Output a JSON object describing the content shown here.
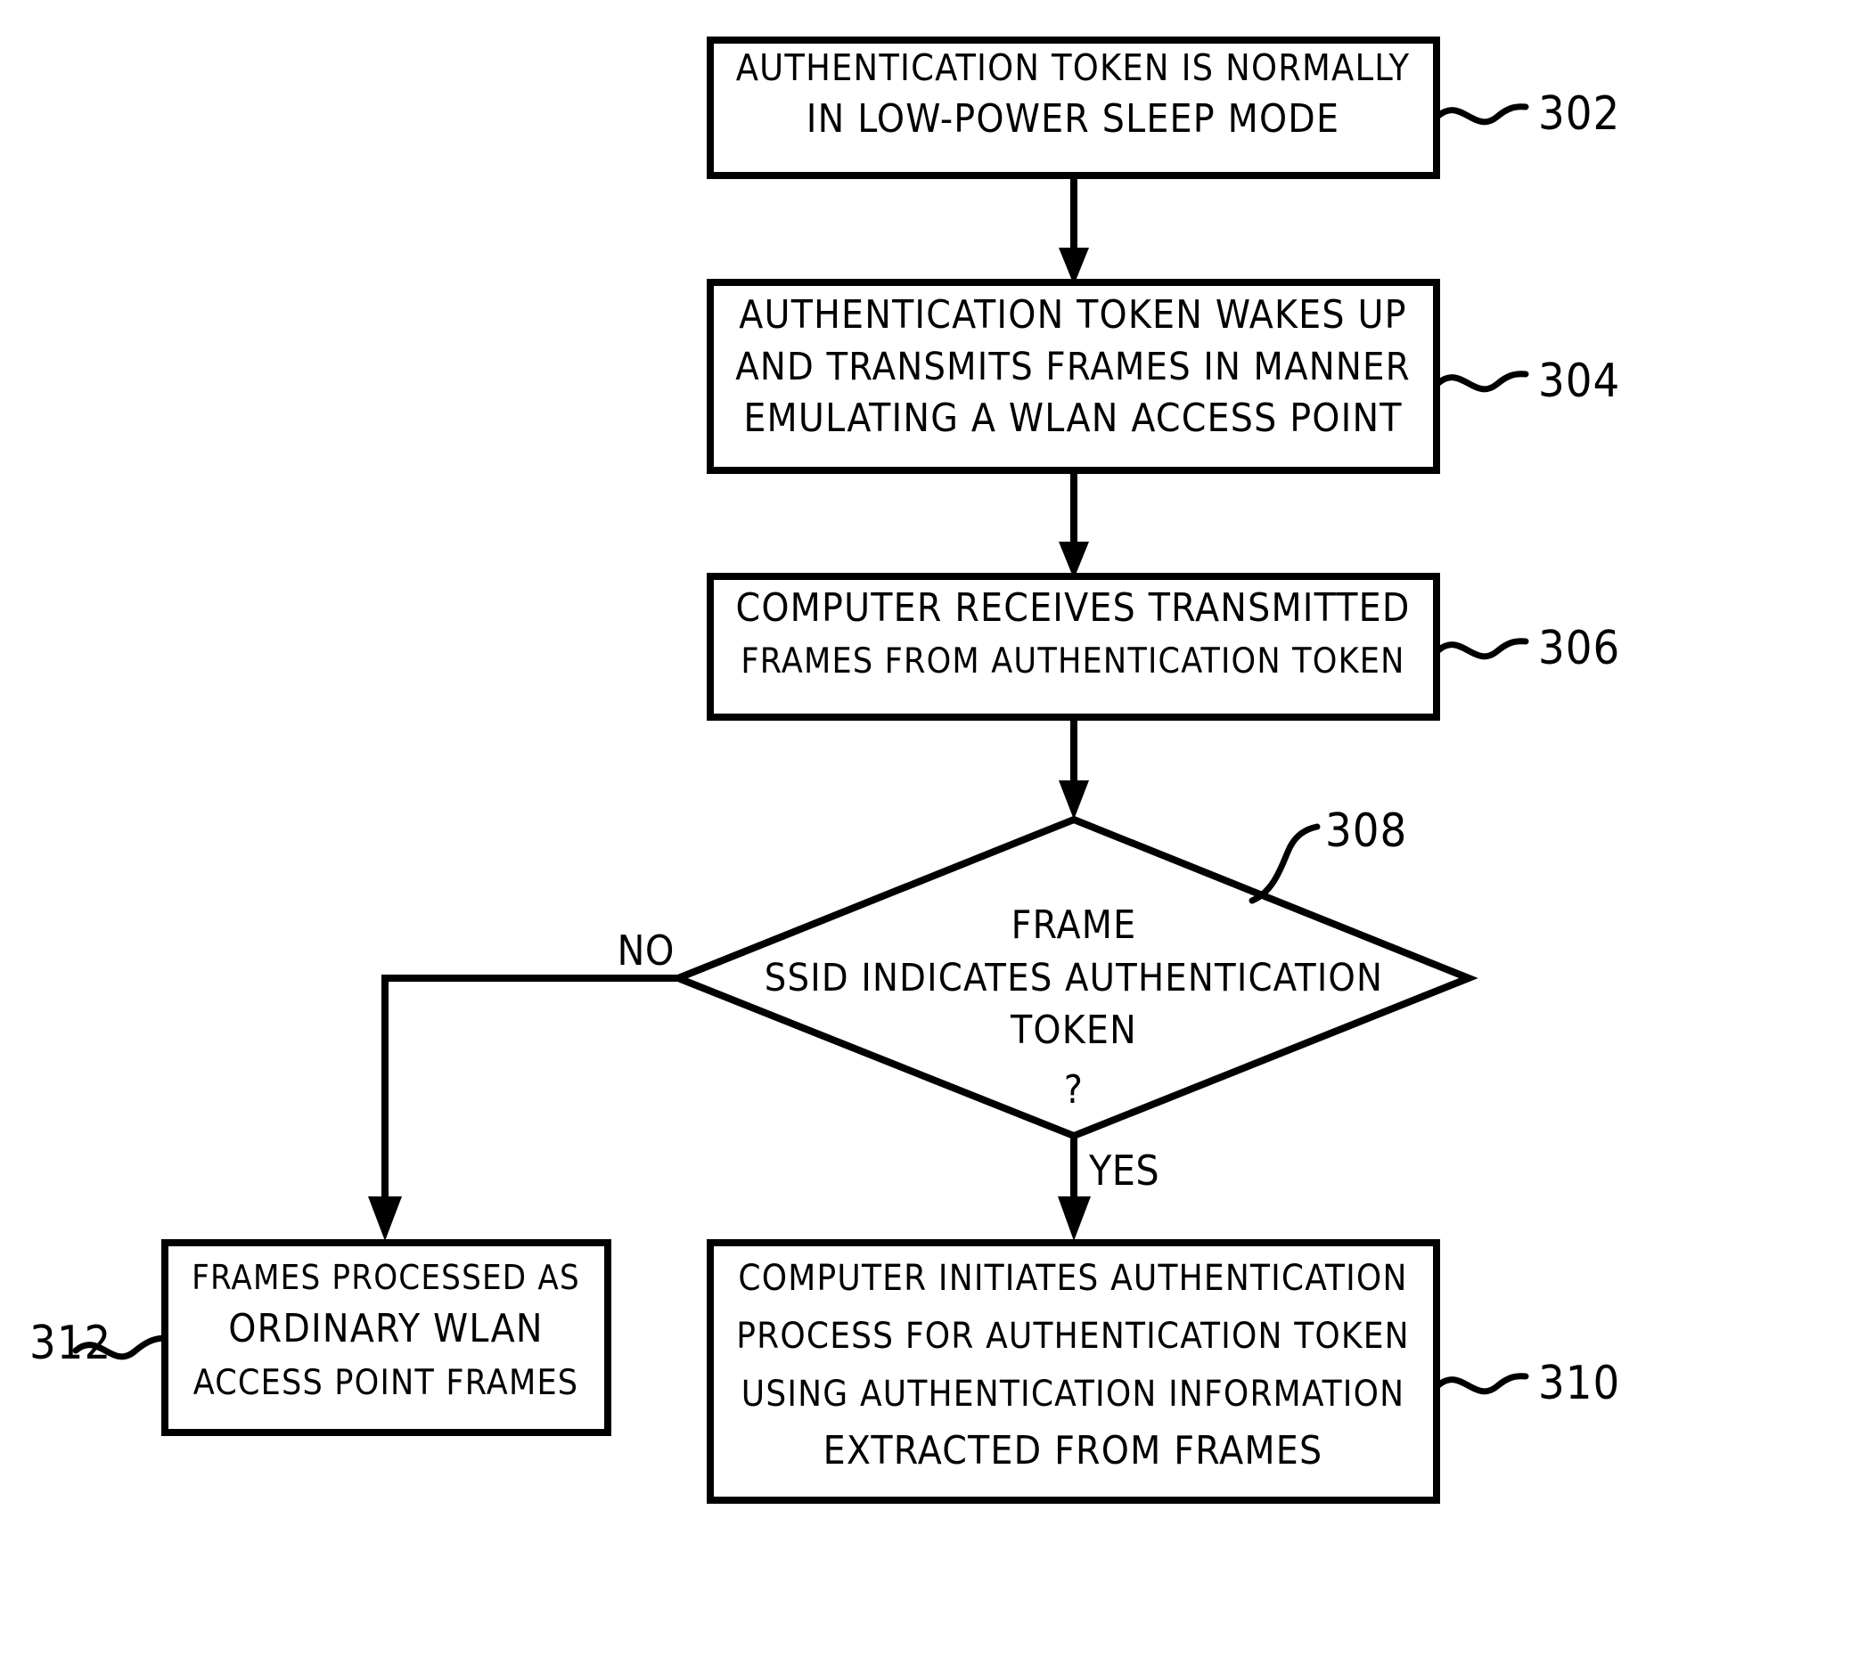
{
  "figure": {
    "type": "flowchart",
    "title": "",
    "background_color": "#ffffff",
    "line_color": "#000000"
  },
  "nodes": {
    "n302": {
      "ref": "302",
      "shape": "rectangle",
      "lines": [
        "AUTHENTICATION TOKEN IS NORMALLY",
        "IN LOW-POWER SLEEP MODE"
      ]
    },
    "n304": {
      "ref": "304",
      "shape": "rectangle",
      "lines": [
        "AUTHENTICATION TOKEN WAKES UP",
        "AND TRANSMITS FRAMES IN MANNER",
        "EMULATING A WLAN ACCESS POINT"
      ]
    },
    "n306": {
      "ref": "306",
      "shape": "rectangle",
      "lines": [
        "COMPUTER RECEIVES TRANSMITTED",
        "FRAMES FROM AUTHENTICATION TOKEN"
      ]
    },
    "n308": {
      "ref": "308",
      "shape": "diamond",
      "lines": [
        "FRAME",
        "SSID INDICATES AUTHENTICATION",
        "TOKEN",
        "?"
      ]
    },
    "n310": {
      "ref": "310",
      "shape": "rectangle",
      "lines": [
        "COMPUTER INITIATES AUTHENTICATION",
        "PROCESS FOR AUTHENTICATION TOKEN",
        "USING AUTHENTICATION INFORMATION",
        "EXTRACTED FROM FRAMES"
      ]
    },
    "n312": {
      "ref": "312",
      "shape": "rectangle",
      "lines": [
        "FRAMES PROCESSED AS",
        "ORDINARY WLAN",
        "ACCESS POINT FRAMES"
      ]
    }
  },
  "branch_labels": {
    "no": "NO",
    "yes": "YES"
  },
  "edges": [
    {
      "from": "302",
      "to": "304",
      "label": ""
    },
    {
      "from": "304",
      "to": "306",
      "label": ""
    },
    {
      "from": "306",
      "to": "308",
      "label": ""
    },
    {
      "from": "308",
      "to": "312",
      "label": "NO"
    },
    {
      "from": "308",
      "to": "310",
      "label": "YES"
    }
  ]
}
